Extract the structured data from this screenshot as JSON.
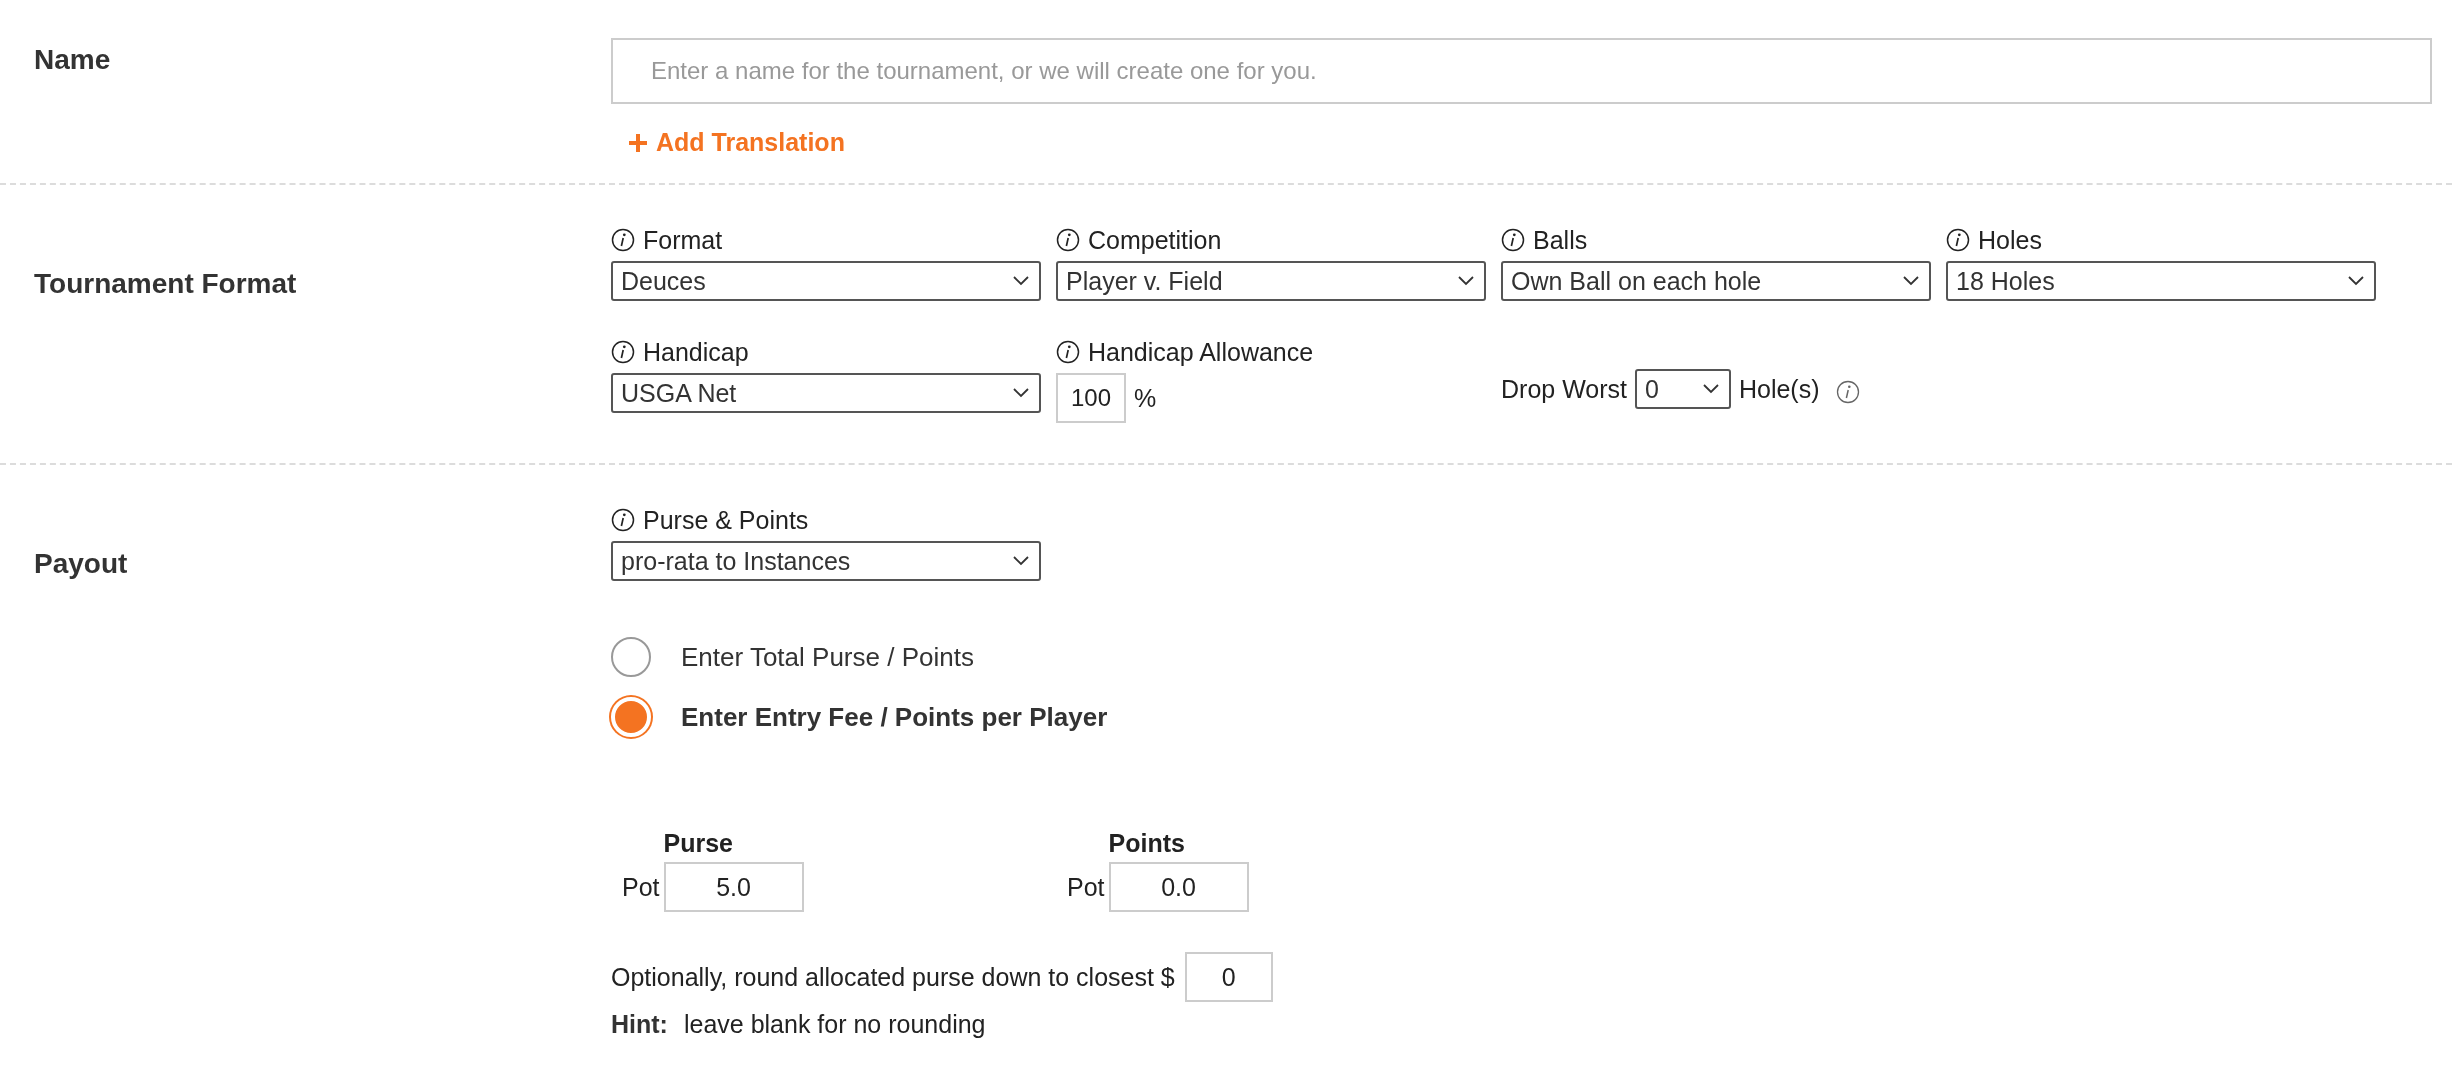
{
  "name_section": {
    "label": "Name",
    "name_field": {
      "placeholder": "Enter a name for the tournament, or we will create one for you."
    },
    "add_translation": {
      "label": "Add Translation"
    }
  },
  "format_section": {
    "label": "Tournament Format",
    "selects": [
      {
        "label": "Format",
        "value": "Deuces"
      },
      {
        "label": "Competition",
        "value": "Player v. Field"
      },
      {
        "label": "Balls",
        "value": "Own Ball on each hole"
      },
      {
        "label": "Holes",
        "value": "18 Holes"
      }
    ],
    "handicap": {
      "label": "Handicap",
      "value": "USGA Net"
    },
    "allowance": {
      "label": "Handicap Allowance",
      "value": "100",
      "unit": "%"
    },
    "drop_worst": {
      "label": "Drop Worst",
      "value": "0",
      "suffix": "Hole(s)"
    }
  },
  "payout_section": {
    "label": "Payout",
    "purse_points": {
      "label": "Purse & Points",
      "value": "pro-rata to Instances"
    },
    "options": [
      {
        "label": "Enter Total Purse / Points",
        "selected": false
      },
      {
        "label": "Enter Entry Fee / Points per Player",
        "selected": true
      }
    ],
    "pots": [
      {
        "heading": "Purse",
        "label": "Pot",
        "value": "5.0"
      },
      {
        "heading": "Points",
        "label": "Pot",
        "value": "0.0"
      }
    ],
    "rounding": {
      "label": "Optionally, round allocated purse down to closest $",
      "value": "0"
    },
    "hint": {
      "label": "Hint:",
      "text": "leave blank for no rounding"
    }
  }
}
